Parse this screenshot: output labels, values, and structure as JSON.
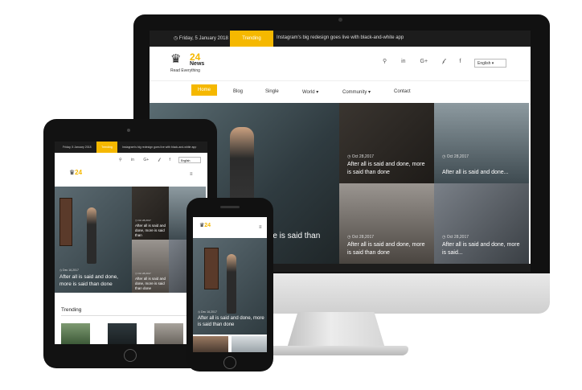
{
  "site": {
    "date": "Friday, 5 January 2018",
    "trending_label": "Trending",
    "headline": "Instagram's big redesign goes live with black-and-white app",
    "logo_number": "24",
    "logo_word": "News",
    "logo_tagline": "Read Everything",
    "language": "English",
    "social_icons": [
      "search-icon",
      "linkedin-icon",
      "google-plus-icon",
      "twitter-icon",
      "facebook-icon"
    ],
    "nav": [
      "Home",
      "Blog",
      "Single",
      "World ▾",
      "Community ▾",
      "Contact"
    ],
    "hero_partial": "re is said than",
    "tiles": [
      {
        "date": "Oct 28,2017",
        "title": "After all is said and done, more is said than done"
      },
      {
        "date": "Oct 28,2017",
        "title": "After all is said and done..."
      },
      {
        "date": "Oct 28,2017",
        "title": "After all is said and done, more is said than done"
      },
      {
        "date": "Oct 28,2017",
        "title": "After all is said and done, more is said..."
      }
    ]
  },
  "tablet": {
    "hero_date": "Dec 16,2017",
    "hero_title": "After all is said and done, more is said than done",
    "tiles": [
      {
        "date": "Oct 28,2017",
        "title": "After all is said and done, more is said than"
      },
      {
        "date": "Oct 28,2017",
        "title": "After all is said and done, more is said than done"
      }
    ],
    "trending_heading": "Trending"
  },
  "phone": {
    "hero_date": "Dec 16,2017",
    "hero_title": "After all is said and done, more is said than done"
  },
  "icons": {
    "crown": "♛",
    "hamburger": "≡",
    "clock": "◷"
  },
  "colors": {
    "accent": "#f5b800",
    "dark": "#1c1c1c"
  }
}
